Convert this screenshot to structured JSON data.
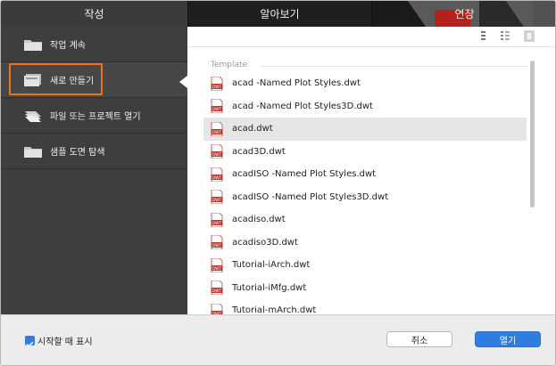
{
  "tabs": [
    {
      "label": "작성"
    },
    {
      "label": "알아보기"
    },
    {
      "label": "연장"
    }
  ],
  "sidebar": {
    "items": [
      {
        "label": "작업 계속",
        "icon": "folder-icon"
      },
      {
        "label": "새로 만들기",
        "icon": "new-drawing-icon"
      },
      {
        "label": "파일 또는 프로젝트 열기",
        "icon": "open-files-icon"
      },
      {
        "label": "샘플 도면 탐색",
        "icon": "folder-icon"
      }
    ]
  },
  "panel": {
    "section_title": "Template",
    "files": [
      "acad -Named Plot Styles.dwt",
      "acad -Named Plot Styles3D.dwt",
      "acad.dwt",
      "acad3D.dwt",
      "acadISO -Named Plot Styles.dwt",
      "acadISO -Named Plot Styles3D.dwt",
      "acadiso.dwt",
      "acadiso3D.dwt",
      "Tutorial-iArch.dwt",
      "Tutorial-iMfg.dwt",
      "Tutorial-mArch.dwt"
    ],
    "selected_file": "acad.dwt",
    "file_icon_label": "DWT"
  },
  "footer": {
    "show_on_startup_label": "시작할 때 표시",
    "show_on_startup_checked": true,
    "cancel_label": "취소",
    "open_label": "열기"
  },
  "colors": {
    "accent": "#2f7de0",
    "highlight": "#e8741f",
    "sidebar": "#3e3e3e",
    "tab_active": "#3b3b3b"
  }
}
